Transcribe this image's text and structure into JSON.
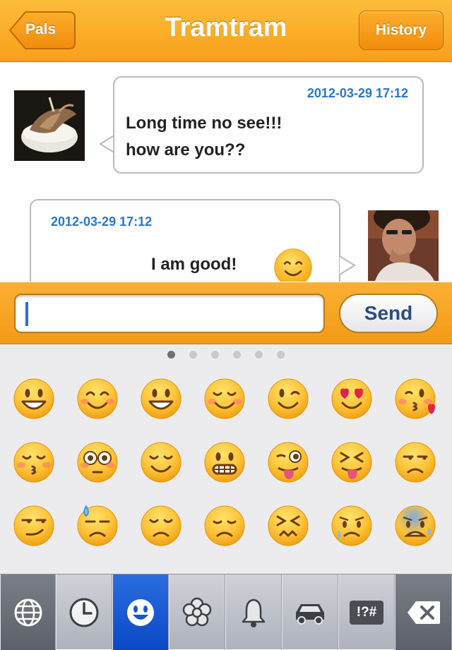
{
  "navbar": {
    "title": "Tramtram",
    "back_label": "Pals",
    "history_label": "History"
  },
  "messages": [
    {
      "side": "left",
      "timestamp": "2012-03-29 17:12",
      "lines": [
        "Long time no see!!!",
        "how are you??"
      ],
      "avatar": "food-photo-avatar"
    },
    {
      "side": "right",
      "timestamp": "2012-03-29 17:12",
      "text": "I am good!",
      "emoji": "smiling-face-icon",
      "avatar": "person-photo-avatar"
    }
  ],
  "composer": {
    "value": "",
    "placeholder": "",
    "send_label": "Send"
  },
  "keyboard": {
    "pages": 6,
    "active_page": 1,
    "emoji_rows": [
      [
        "grinning",
        "blush",
        "smiley",
        "relaxed",
        "wink",
        "heart-eyes",
        "kissing-heart"
      ],
      [
        "kissing-closed-eyes",
        "flushed",
        "relieved",
        "grimacing",
        "stuck-out-tongue-winking-eye",
        "stuck-out-tongue-closed-eyes",
        "unamused"
      ],
      [
        "smirk",
        "sweat",
        "pensive",
        "disappointed",
        "confounded",
        "disappointed-relieved",
        "cold-sweat"
      ]
    ],
    "toolbar": [
      "globe-icon",
      "clock-icon",
      "smiley-icon",
      "flower-icon",
      "bell-icon",
      "car-icon",
      "symbols-key",
      "delete-icon"
    ],
    "symbols_label": "!?#",
    "active_tab": "smiley-icon"
  },
  "colors": {
    "nav_orange": "#f7a019",
    "timestamp_blue": "#2a76c9",
    "active_tab_blue": "#1457d2",
    "bubble_border": "#b9b9bf"
  }
}
